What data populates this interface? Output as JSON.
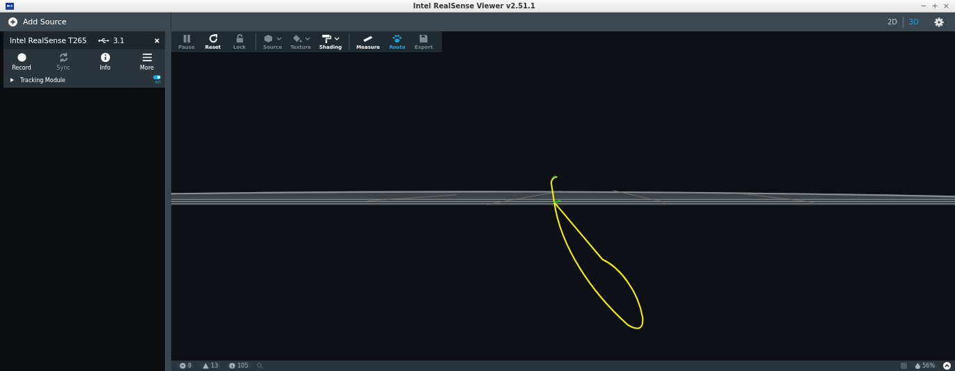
{
  "window": {
    "title": "Intel RealSense Viewer v2.51.1",
    "controls": [
      "−",
      "+",
      "×"
    ]
  },
  "add_source": {
    "label": "Add Source"
  },
  "view_modes": [
    {
      "label": "2D",
      "selected": false
    },
    {
      "label": "3D",
      "selected": true
    }
  ],
  "device": {
    "name": "Intel RealSense T265",
    "usb": "3.1",
    "actions": [
      {
        "label": "Record",
        "kind": "record",
        "disabled": false
      },
      {
        "label": "Sync",
        "kind": "sync",
        "disabled": true
      },
      {
        "label": "Info",
        "kind": "info",
        "disabled": false
      },
      {
        "label": "More",
        "kind": "more",
        "disabled": false
      }
    ],
    "modules": [
      {
        "name": "Tracking Module",
        "expanded": false,
        "on": true,
        "state_label": "on"
      }
    ]
  },
  "toolbar_groups": [
    [
      {
        "label": "Pause",
        "kind": "pause",
        "disabled": true,
        "selected": false,
        "dropdown": false
      },
      {
        "label": "Reset",
        "kind": "reset",
        "disabled": false,
        "selected": false,
        "dropdown": false
      },
      {
        "label": "Lock",
        "kind": "lock",
        "disabled": true,
        "selected": false,
        "dropdown": false
      }
    ],
    [
      {
        "label": "Source",
        "kind": "cube",
        "disabled": true,
        "selected": false,
        "dropdown": true
      },
      {
        "label": "Texture",
        "kind": "bucket",
        "disabled": true,
        "selected": false,
        "dropdown": true
      },
      {
        "label": "Shading",
        "kind": "roller",
        "disabled": false,
        "selected": false,
        "dropdown": true
      }
    ],
    [
      {
        "label": "Measure",
        "kind": "ruler",
        "disabled": false,
        "selected": false,
        "dropdown": false
      },
      {
        "label": "Route",
        "kind": "paw",
        "disabled": false,
        "selected": true,
        "dropdown": false
      },
      {
        "label": "Export",
        "kind": "save",
        "disabled": true,
        "selected": false,
        "dropdown": false
      }
    ]
  ],
  "status_bar": {
    "counters": [
      {
        "kind": "error",
        "count": "8"
      },
      {
        "kind": "warning",
        "count": "13"
      },
      {
        "kind": "info",
        "count": "105"
      }
    ],
    "battery": "56%"
  }
}
